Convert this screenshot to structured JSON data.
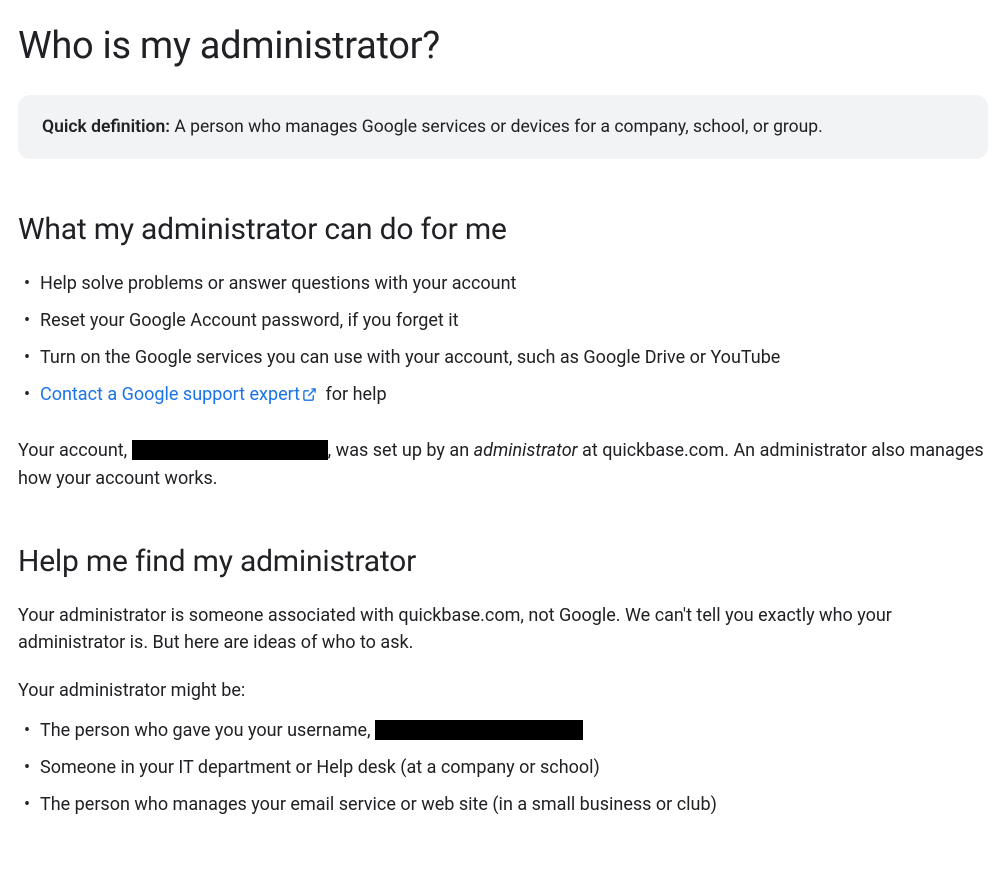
{
  "title": "Who is my administrator?",
  "definition": {
    "label": "Quick definition:",
    "text": " A person who manages Google services or devices for a company, school, or group."
  },
  "section1": {
    "heading": "What my administrator can do for me",
    "items": [
      "Help solve problems or answer questions with your account",
      "Reset your Google Account password, if you forget it",
      "Turn on the Google services you can use with your account, such as Google Drive or YouTube"
    ],
    "contact_link": "Contact a Google support expert",
    "contact_suffix": " for help",
    "account_para": {
      "prefix": "Your account, ",
      "mid": ", was set up by an ",
      "admin_word": "administrator",
      "suffix": " at quickbase.com. An administrator also manages how your account works."
    }
  },
  "section2": {
    "heading": "Help me find my administrator",
    "intro": "Your administrator is someone associated with quickbase.com, not Google. We can't tell you exactly who your administrator is. But here are ideas of who to ask.",
    "might_be": "Your  administrator might be:",
    "items": {
      "a_prefix": "The person who gave you your username, ",
      "b": "Someone in your IT department or Help desk (at a company or school)",
      "c": "The person who manages your email service or web site (in a small business or club)"
    }
  }
}
